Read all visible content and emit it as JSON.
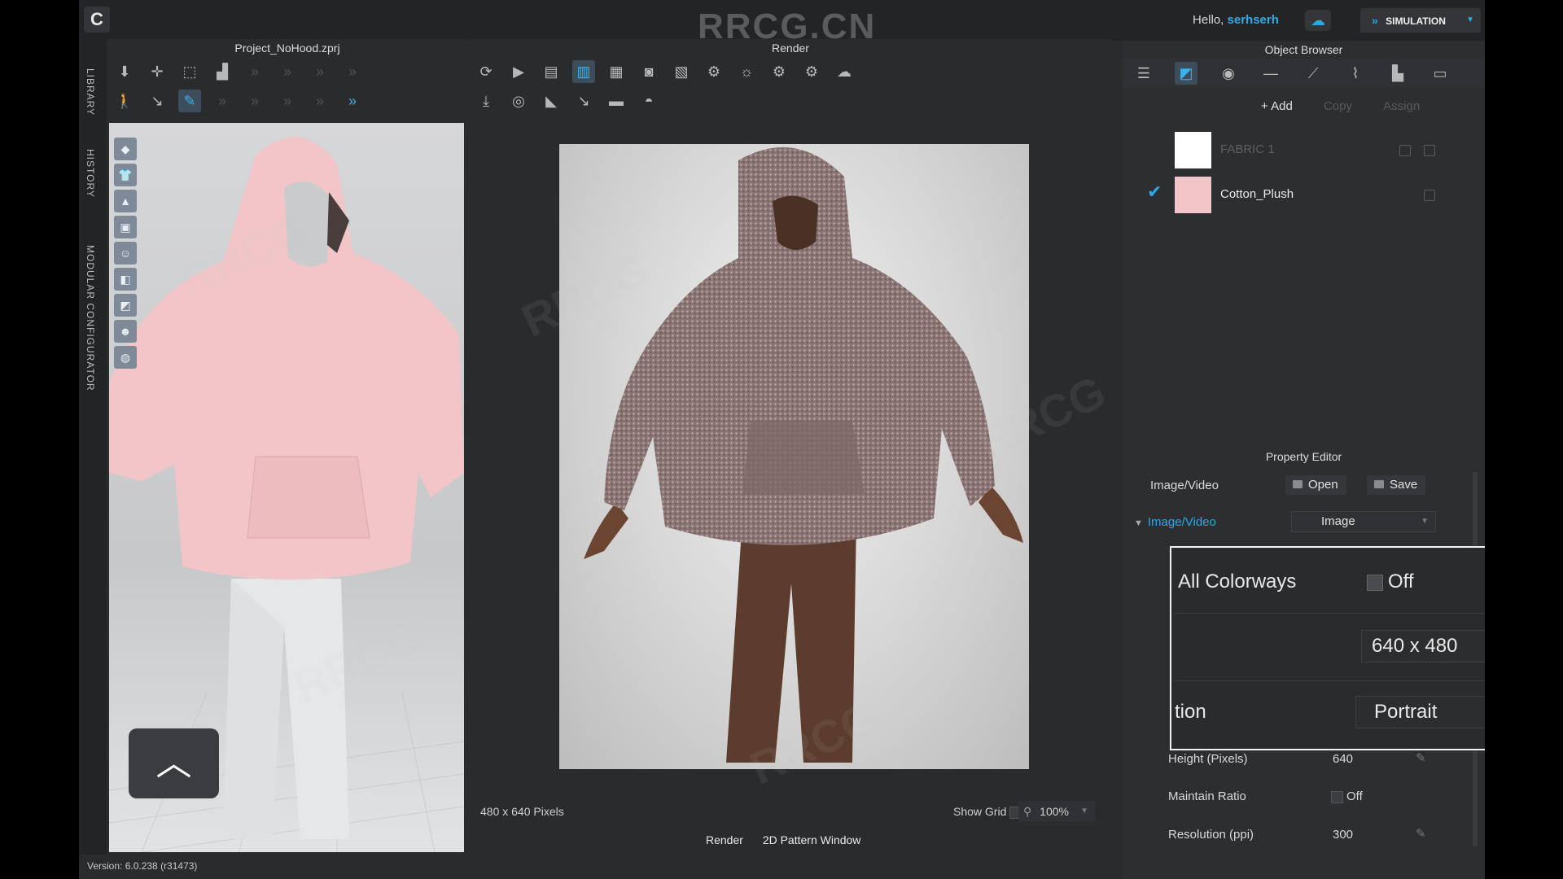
{
  "app": {
    "watermark": "RRCG.CN",
    "logo_glyph": "C"
  },
  "user": {
    "greeting": "Hello,",
    "name": "serhserh"
  },
  "simulation": {
    "label": "SIMULATION"
  },
  "left_rail": {
    "library": "LIBRARY",
    "history": "HISTORY",
    "modular": "MODULAR CONFIGURATOR"
  },
  "viewport_3d": {
    "title": "Project_NoHood.zprj"
  },
  "render_window": {
    "title": "Render",
    "size_label": "480 x 640 Pixels",
    "show_grid_label": "Show Grid",
    "zoom": "100%",
    "tabs": [
      "Render",
      "2D Pattern Window"
    ]
  },
  "object_browser": {
    "title": "Object Browser",
    "add": "+ Add",
    "copy": "Copy",
    "assign": "Assign",
    "fabrics": [
      {
        "name": "FABRIC 1",
        "color": "#ffffff",
        "active": false
      },
      {
        "name": "Cotton_Plush",
        "color": "#f2c6c8",
        "active": true
      }
    ]
  },
  "property_editor": {
    "title": "Property Editor",
    "image_video_label": "Image/Video",
    "open": "Open",
    "save": "Save",
    "section": "Image/Video",
    "mode_value": "Image",
    "all_colorways_label": "All Colorways",
    "all_colorways_value": "Off",
    "size_value": "640 x 480",
    "orientation_label_fragment": "tion",
    "orientation_value": "Portrait",
    "height_label": "Height (Pixels)",
    "height_value": "640",
    "maintain_ratio_label": "Maintain Ratio",
    "maintain_ratio_value": "Off",
    "resolution_label": "Resolution (ppi)",
    "resolution_value": "300"
  },
  "version": "Version: 6.0.238 (r31473)",
  "colors": {
    "accent": "#29a9e8",
    "panel_bg": "#2a2b2d",
    "garment_pink": "#f2c6c8",
    "plush_brown": "#8a7574"
  }
}
